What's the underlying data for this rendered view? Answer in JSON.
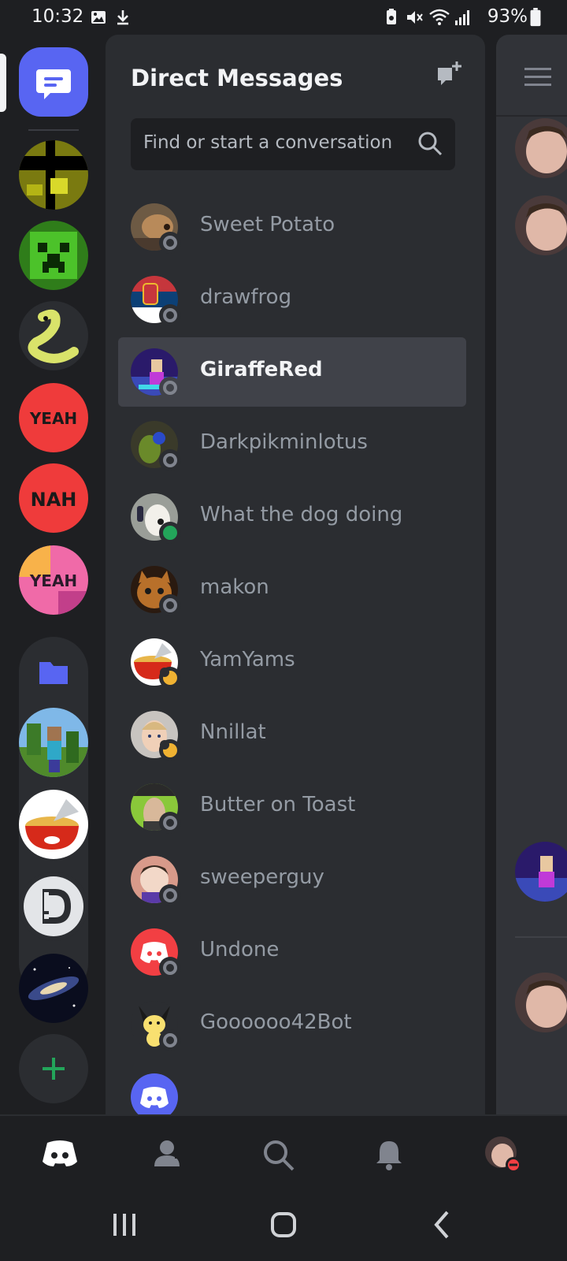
{
  "status_bar": {
    "time": "10:32",
    "battery": "93%"
  },
  "dm_panel": {
    "title": "Direct Messages",
    "search_placeholder": "Find or start a conversation",
    "conversations": [
      {
        "name": "Sweet Potato",
        "status": "offline",
        "active": false
      },
      {
        "name": "drawfrog",
        "status": "offline",
        "active": false
      },
      {
        "name": "GiraffeRed",
        "status": "offline",
        "active": true
      },
      {
        "name": "Darkpikminlotus",
        "status": "offline",
        "active": false
      },
      {
        "name": "What the dog doing",
        "status": "online",
        "active": false
      },
      {
        "name": "makon",
        "status": "offline",
        "active": false
      },
      {
        "name": "YamYams",
        "status": "idle",
        "active": false
      },
      {
        "name": "Nnillat",
        "status": "idle",
        "active": false
      },
      {
        "name": "Butter on Toast",
        "status": "offline",
        "active": false
      },
      {
        "name": "sweeperguy",
        "status": "offline",
        "active": false
      },
      {
        "name": "Undone",
        "status": "offline",
        "active": false
      },
      {
        "name": "Goooooo42Bot",
        "status": "offline",
        "active": false
      },
      {
        "name": "",
        "status": "offline",
        "active": false
      }
    ]
  },
  "servers": [
    {
      "label": "server-1"
    },
    {
      "label": "server-2"
    },
    {
      "label": "server-3"
    },
    {
      "label": "server-yeah-red"
    },
    {
      "label": "server-nah"
    },
    {
      "label": "server-yeah-pink"
    },
    {
      "label": "folder"
    },
    {
      "label": "server-minecraft"
    },
    {
      "label": "server-ramen"
    },
    {
      "label": "server-d"
    },
    {
      "label": "server-galaxy"
    }
  ],
  "colors": {
    "accent": "#5865f2",
    "online": "#23a55a",
    "idle": "#f0b232",
    "offline": "#80848e",
    "dnd": "#f23f43",
    "add_server": "#23a55a"
  },
  "bottom_nav": [
    "home-icon",
    "friends-icon",
    "search-icon",
    "notifications-icon",
    "profile-avatar"
  ]
}
